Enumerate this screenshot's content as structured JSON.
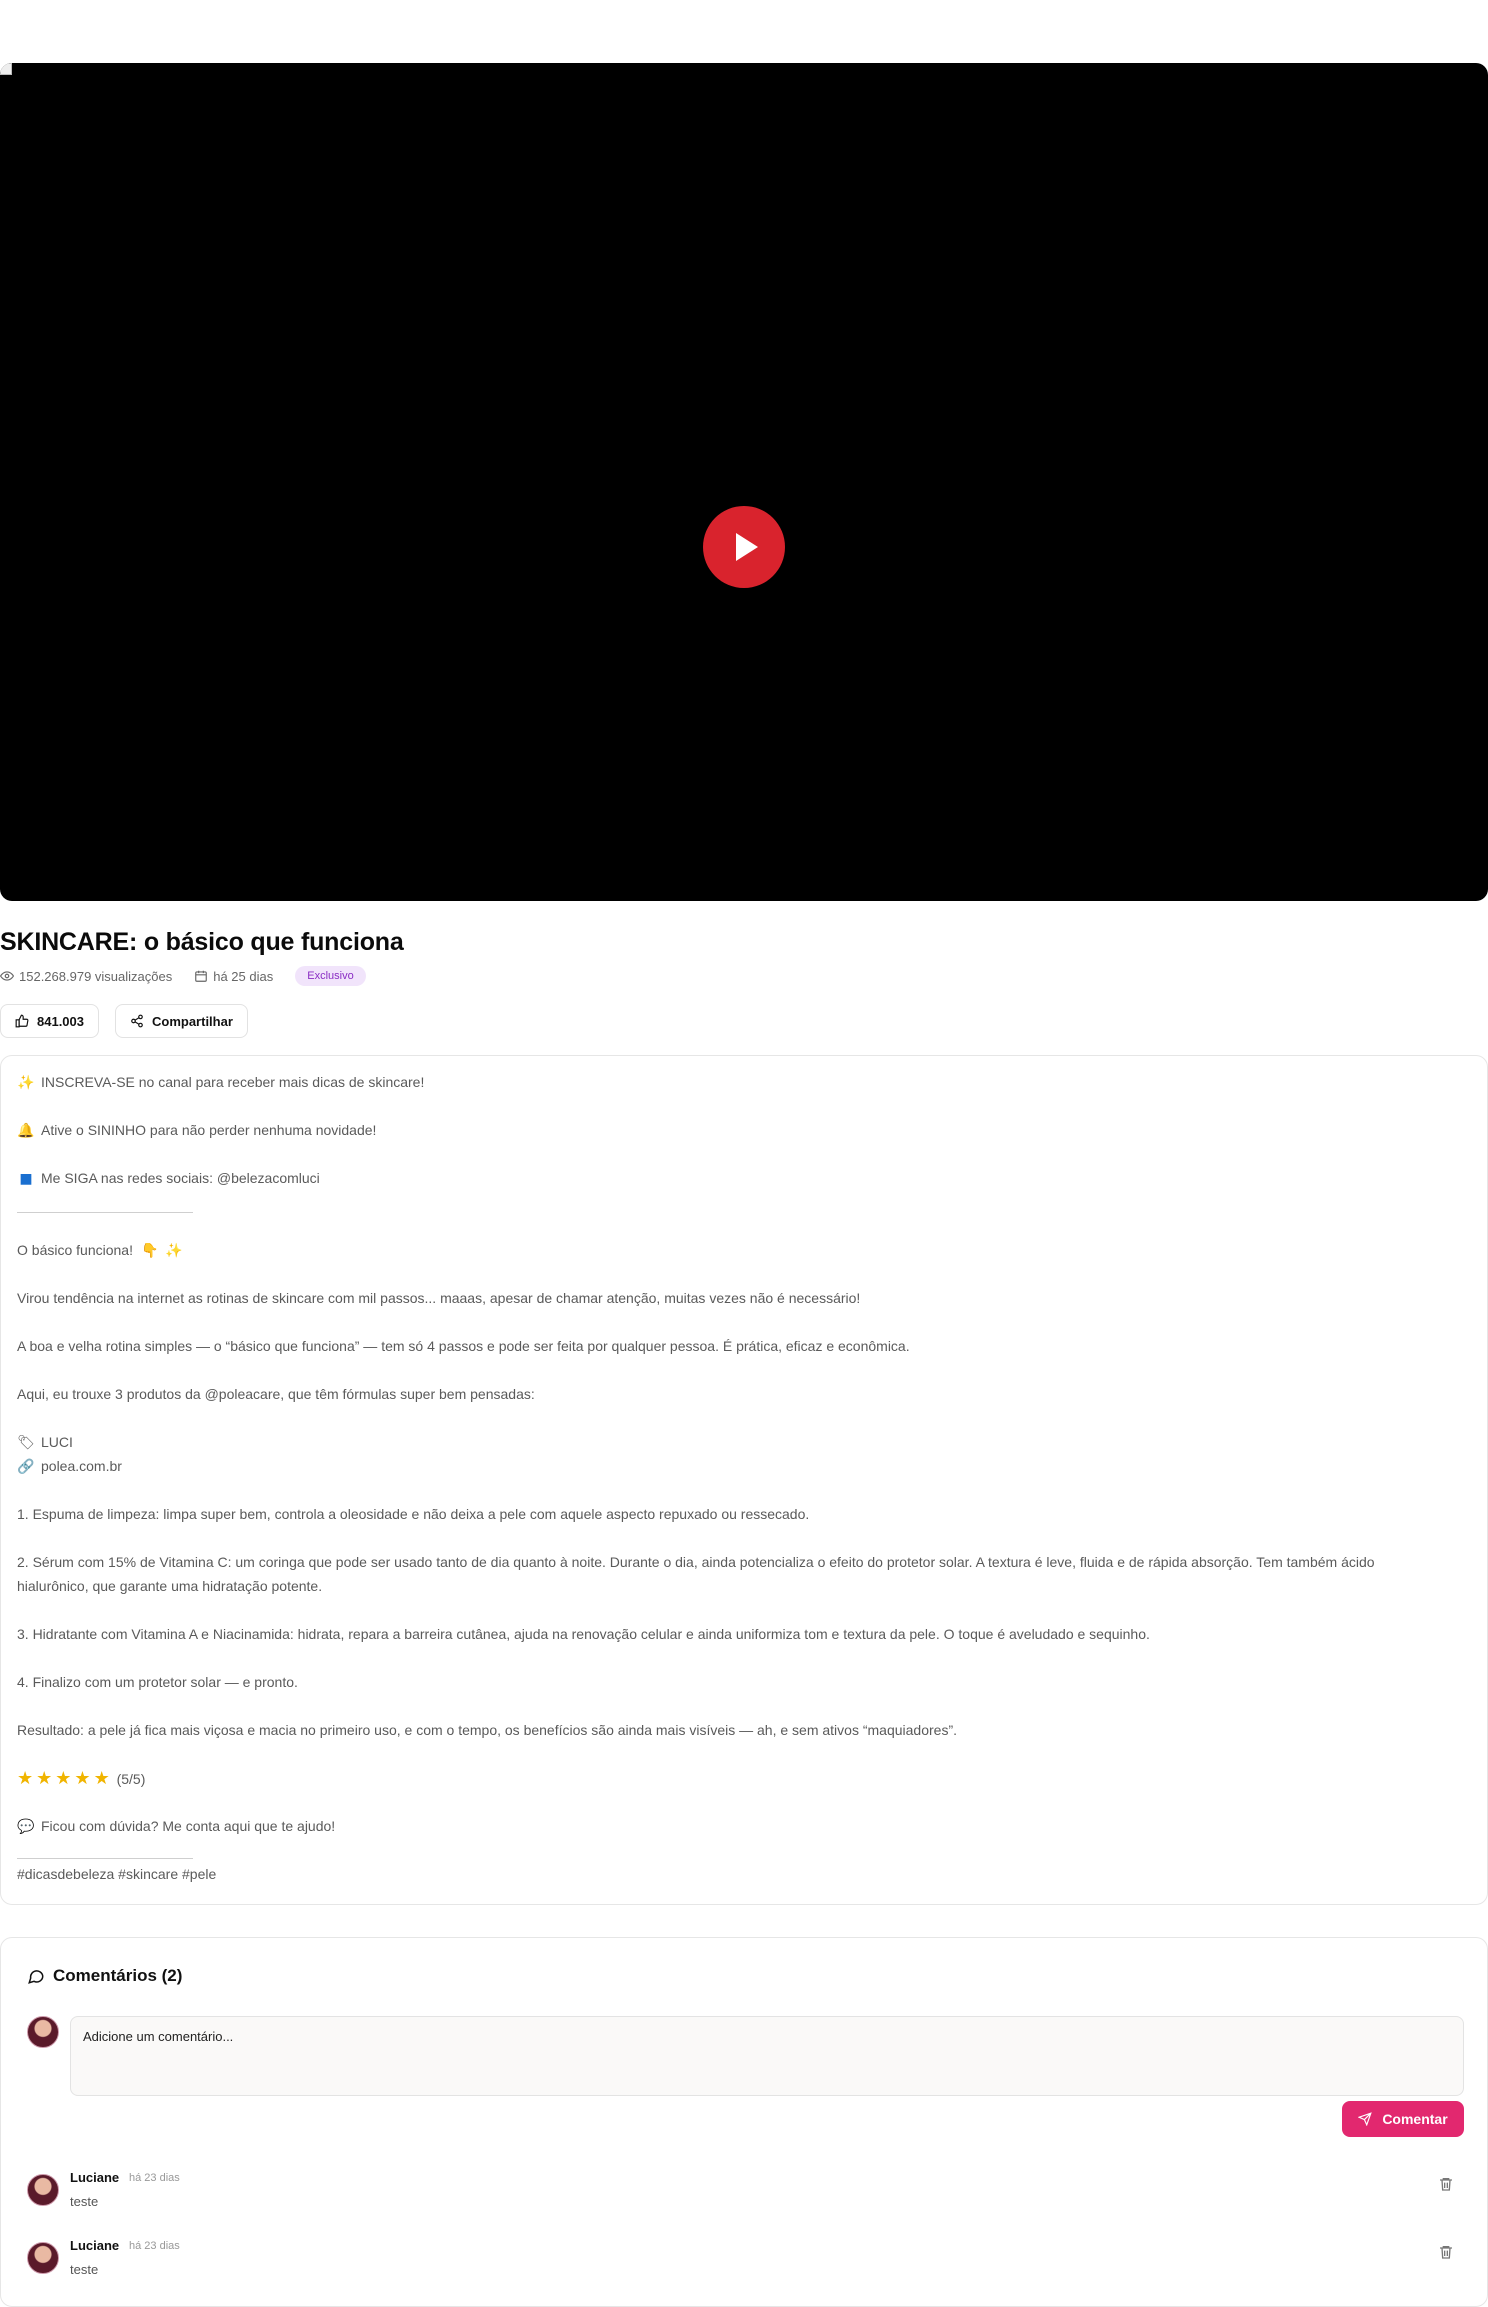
{
  "video": {
    "title": "SKINCARE: o básico que funciona",
    "views": "152.268.979 visualizações",
    "date": "há 25 dias",
    "badge": "Exclusivo",
    "likes": "841.003",
    "share_label": "Compartilhar"
  },
  "description": {
    "cta_subscribe": "INSCREVA-SE no canal para receber mais dicas de skincare!",
    "cta_bell": "Ative o SININHO para não perder nenhuma novidade!",
    "cta_follow": "Me SIGA nas redes sociais: @belezacomluci",
    "intro": "O básico funciona!",
    "p1": "Virou tendência na internet as rotinas de skincare com mil passos... maaas, apesar de chamar atenção, muitas vezes não é necessário!",
    "p2": "A boa e velha rotina simples — o “básico que funciona” — tem só 4 passos e pode ser feita por qualquer pessoa. É prática, eficaz e econômica.",
    "p3": "Aqui, eu trouxe 3 produtos da @poleacare, que têm fórmulas super bem pensadas:",
    "coupon": "LUCI",
    "site": "polea.com.br",
    "step1": "1. Espuma de limpeza: limpa super bem, controla a oleosidade e não deixa a pele com aquele aspecto repuxado ou ressecado.",
    "step2": "2. Sérum com 15% de Vitamina C: um coringa que pode ser usado tanto de dia quanto à noite. Durante o dia, ainda potencializa o efeito do protetor solar. A textura é leve, fluida e de rápida absorção. Tem também ácido hialurônico, que garante uma hidratação potente.",
    "step3": "3. Hidratante com Vitamina A e Niacinamida: hidrata, repara a barreira cutânea, ajuda na renovação celular e ainda uniformiza tom e textura da pele. O toque é aveludado e sequinho.",
    "step4": "4. Finalizo com um protetor solar — e pronto.",
    "result": "Resultado: a pele já fica mais viçosa e macia no primeiro uso, e com o tempo, os benefícios são ainda mais visíveis — ah, e sem ativos “maquiadores”.",
    "rating_text": "(5/5)",
    "rating_value": 5,
    "question": "Ficou com dúvida? Me conta aqui que te ajudo!",
    "hashtags": "#dicasdebeleza #skincare #pele"
  },
  "comments": {
    "heading": "Comentários (2)",
    "input_placeholder": "Adicione um comentário...",
    "submit_label": "Comentar",
    "items": [
      {
        "author": "Luciane",
        "time": "há 23 dias",
        "text": "teste"
      },
      {
        "author": "Luciane",
        "time": "há 23 dias",
        "text": "teste"
      }
    ]
  },
  "colors": {
    "play_button": "#d9232d",
    "badge_text": "#8a2dc4",
    "badge_bg": "#f1e4fb",
    "submit_button": "#e2286f"
  },
  "icons": {
    "views": "eye-icon",
    "date": "calendar-icon",
    "like": "thumbs-up-icon",
    "share": "share-icon",
    "comments": "speech-bubble-icon",
    "send": "paper-plane-icon",
    "delete": "trash-icon"
  }
}
